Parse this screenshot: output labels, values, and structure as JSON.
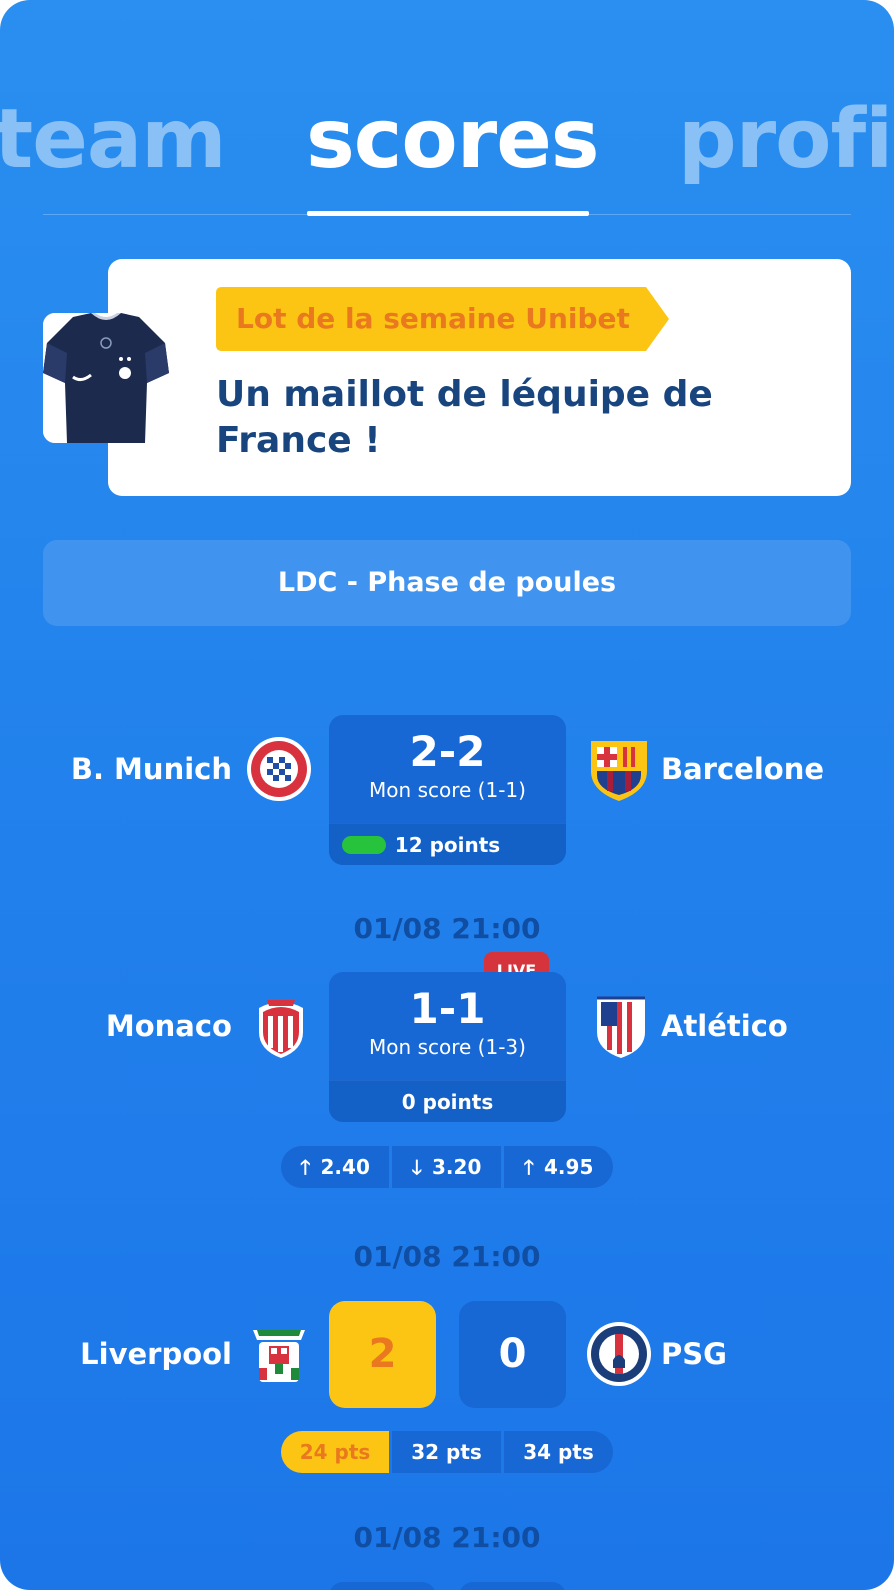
{
  "tabs": {
    "team": "team",
    "scores": "scores",
    "profil": "profi"
  },
  "promo": {
    "badge": "Lot de la semaine Unibet",
    "title": "Un maillot de léquipe de France !",
    "badge_color": "#fcc514",
    "title_color": "#18457e",
    "image": "france-jersey"
  },
  "competition": {
    "label": "LDC - Phase de poules"
  },
  "matches": [
    {
      "home": "B. Munich",
      "away": "Barcelone",
      "home_crest": "munich-crest-icon",
      "away_crest": "barcelona-crest-icon",
      "score": "2-2",
      "my_score": "Mon score (1-1)",
      "points": "12 points"
    },
    {
      "date": "01/08 21:00",
      "live": "LIVE",
      "home": "Monaco",
      "away": "Atlético",
      "home_crest": "monaco-crest-icon",
      "away_crest": "atletico-crest-icon",
      "score": "1-1",
      "my_score": "Mon score (1-3)",
      "points": "0 points",
      "odds": [
        {
          "arrow": "up",
          "value": "2.40"
        },
        {
          "arrow": "down",
          "value": "3.20"
        },
        {
          "arrow": "up",
          "value": "4.95"
        }
      ]
    },
    {
      "date": "01/08 21:00",
      "home": "Liverpool",
      "away": "PSG",
      "home_crest": "liverpool-crest-icon",
      "away_crest": "psg-crest-icon",
      "home_guess": "2",
      "away_guess": "0",
      "pts": [
        "24 pts",
        "32 pts",
        "34 pts"
      ]
    },
    {
      "date": "01/08 21:00"
    }
  ],
  "colors": {
    "accent": "#fcc514",
    "accent_text": "#e9781e",
    "live": "#d5343c",
    "card": "#1767d4",
    "points_ok": "#27c33c"
  }
}
